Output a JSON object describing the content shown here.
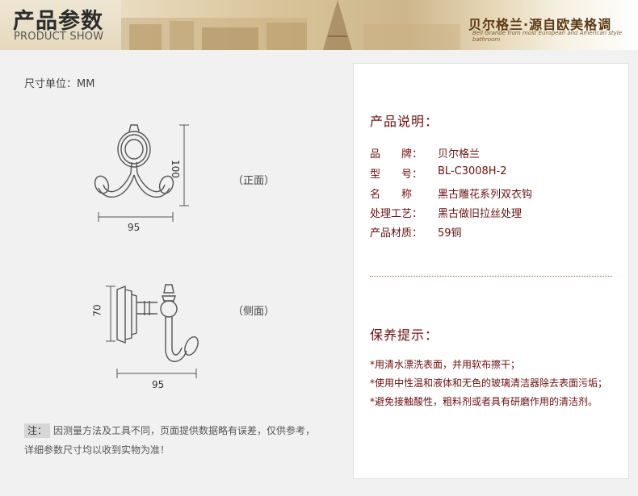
{
  "header": {
    "title_cn": "产品参数",
    "title_en": "PRODUCT SHOW",
    "slogan": "贝尔格兰·源自欧美格调",
    "slogan_en": "Bell Grande from most European and American style bathroom"
  },
  "drawing": {
    "unit_label": "尺寸单位：MM",
    "front_label": "（正面）",
    "side_label": "（侧面）",
    "front_height": "100",
    "front_width": "95",
    "side_height": "70",
    "side_width": "95"
  },
  "note": {
    "tag": "注：",
    "line1": "因测量方法及工具不同，页面提供数据略有误差，仅供参考，",
    "line2": "详细参数尺寸均以收到实物为准！"
  },
  "panel": {
    "desc_title": "产品说明：",
    "specs": [
      {
        "key": "品　　牌：",
        "value": "贝尔格兰"
      },
      {
        "key": "型　　号：",
        "value": "BL-C3008H-2"
      },
      {
        "key": "名　　称",
        "value": "黑古雕花系列双衣钩"
      },
      {
        "key": "处理工艺：",
        "value": "黑古做旧拉丝处理"
      },
      {
        "key": "产品材质：",
        "value": "59铜"
      }
    ],
    "care_title": "保养提示：",
    "tips": [
      "*用清水漂洗表面，并用软布擦干；",
      "*使用中性温和液体和无色的玻璃清洁器除去表面污垢；",
      "*避免接触酸性，粗料剂或者具有研磨作用的清洁剂。"
    ]
  }
}
